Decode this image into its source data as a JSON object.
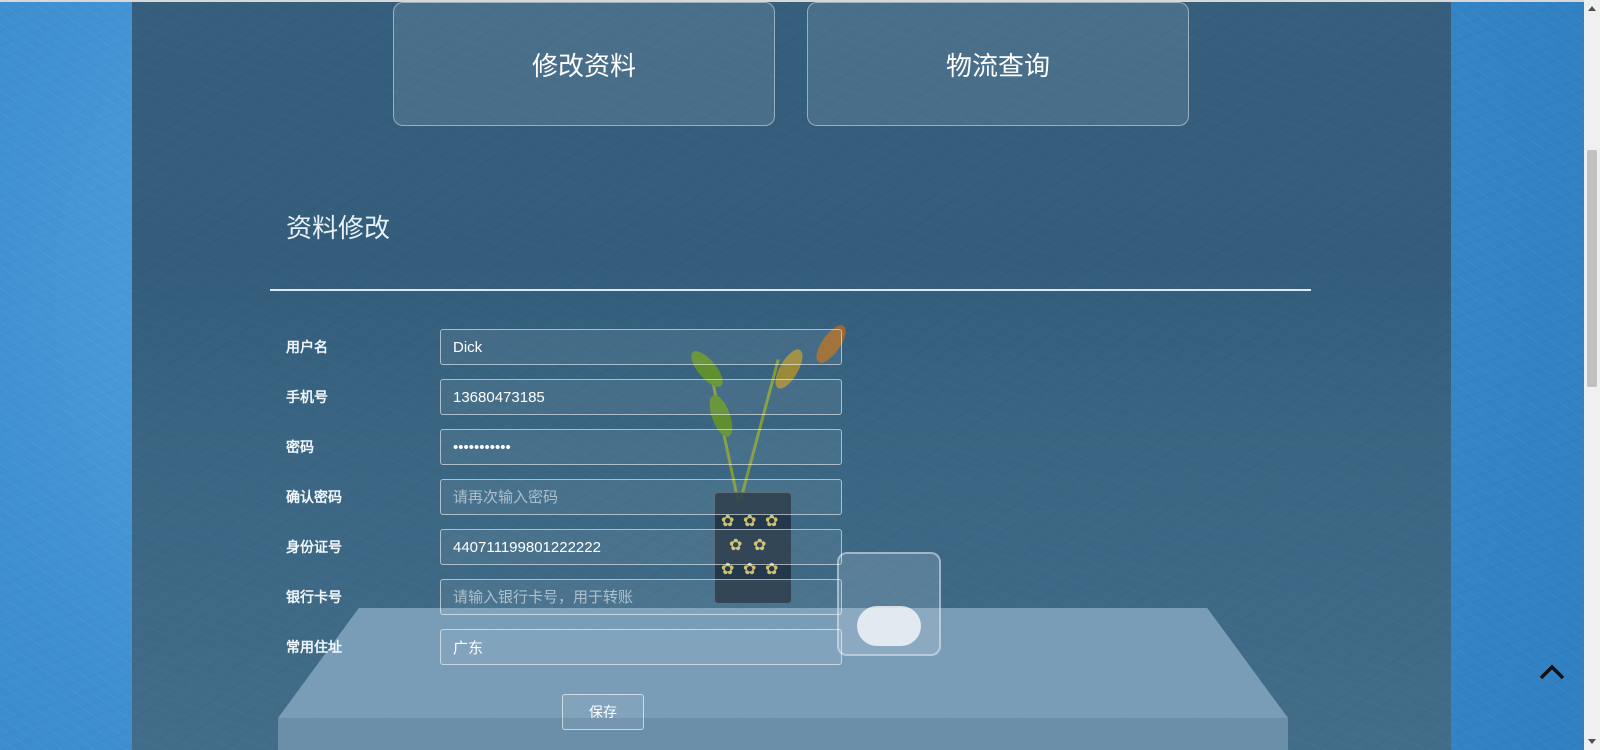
{
  "nav": {
    "tiles": [
      {
        "label": "修改资料"
      },
      {
        "label": "物流查询"
      }
    ]
  },
  "section": {
    "title": "资料修改"
  },
  "form": {
    "fields": [
      {
        "label": "用户名",
        "value": "Dick",
        "placeholder": ""
      },
      {
        "label": "手机号",
        "value": "13680473185",
        "placeholder": ""
      },
      {
        "label": "密码",
        "value": "•••••••••••",
        "placeholder": ""
      },
      {
        "label": "确认密码",
        "value": "",
        "placeholder": "请再次输入密码"
      },
      {
        "label": "身份证号",
        "value": "440711199801222222",
        "placeholder": ""
      },
      {
        "label": "银行卡号",
        "value": "",
        "placeholder": "请输入银行卡号，用于转账"
      },
      {
        "label": "常用住址",
        "value": "广东",
        "placeholder": ""
      }
    ],
    "save_label": "保存"
  },
  "icons": {
    "back_to_top": "chevron-up-icon"
  }
}
